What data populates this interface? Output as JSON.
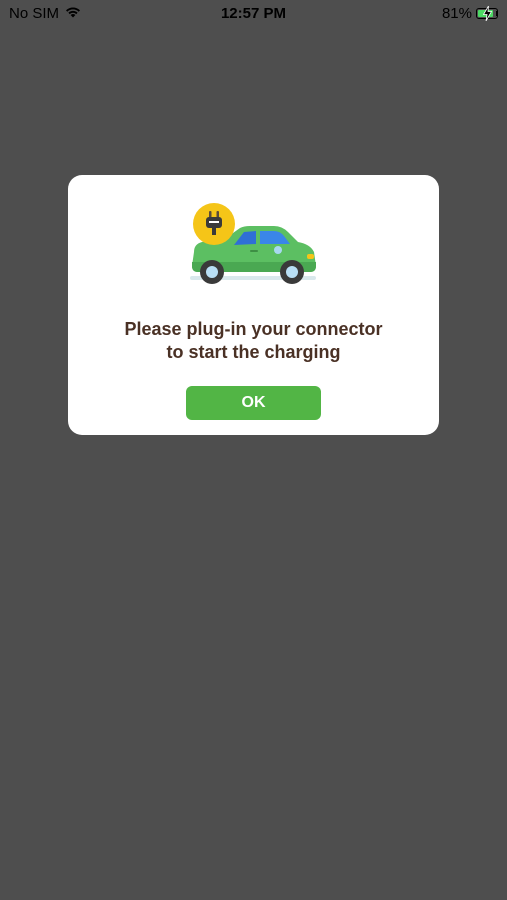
{
  "status_bar": {
    "carrier": "No SIM",
    "time": "12:57 PM",
    "battery_percent": "81%",
    "battery_level": 0.81,
    "wifi_icon": "wifi-icon",
    "battery_icon": "battery-charging-icon"
  },
  "dialog": {
    "illustration_icon": "car-charging-plug-icon",
    "message_line1": "Please plug-in your connector",
    "message_line2": "to start the charging",
    "ok_label": "OK"
  },
  "colors": {
    "overlay": "#4e4e4e",
    "dialog_background": "#ffffff",
    "message_text": "#4a3125",
    "button_background": "#52b545",
    "button_text": "#ffffff",
    "car_body": "#5cbf62",
    "plug_badge": "#f5c518",
    "battery_fill": "#4cd964"
  }
}
